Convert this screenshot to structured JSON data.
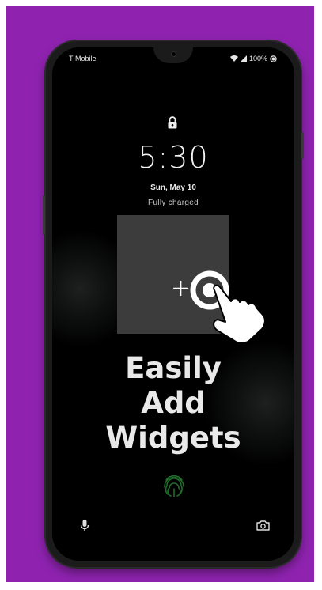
{
  "status_bar": {
    "carrier": "T-Mobile",
    "battery": "100%"
  },
  "lock_screen": {
    "time": "5:30",
    "date": "Sun, May 10",
    "charging_status": "Fully charged"
  },
  "promo": {
    "plus_symbol": "+",
    "headline_line1": "Easily",
    "headline_line2": "Add",
    "headline_line3": "Widgets"
  },
  "colors": {
    "background": "#8f23b0",
    "fingerprint": "#1f6b2c"
  },
  "icons": {
    "lock": "lock-icon",
    "signal": "signal-icon",
    "wifi": "wifi-icon",
    "battery": "battery-icon",
    "tap": "tap-hand-icon",
    "fingerprint": "fingerprint-icon",
    "mic": "microphone-icon",
    "camera": "camera-icon"
  }
}
